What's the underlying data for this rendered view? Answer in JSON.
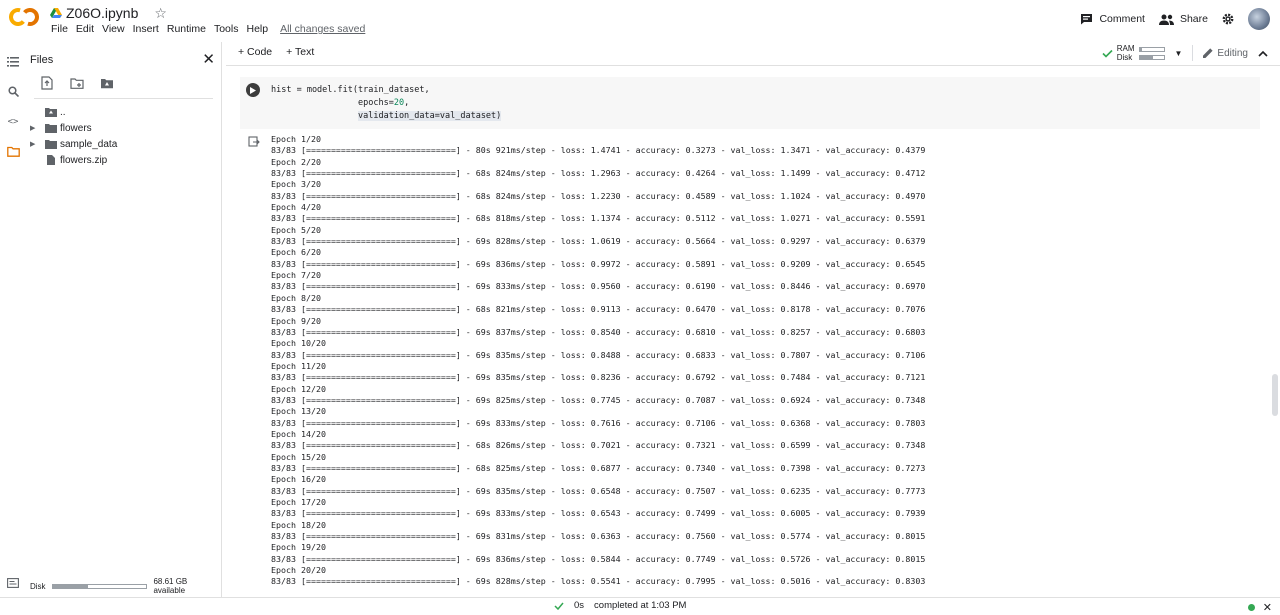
{
  "header": {
    "title": "Z06O.ipynb",
    "menu": [
      "File",
      "Edit",
      "View",
      "Insert",
      "Runtime",
      "Tools",
      "Help"
    ],
    "saved_status": "All changes saved",
    "comment_label": "Comment",
    "share_label": "Share"
  },
  "files": {
    "title": "Files",
    "items": [
      {
        "name": ".."
      },
      {
        "name": "flowers"
      },
      {
        "name": "sample_data"
      },
      {
        "name": "flowers.zip"
      }
    ],
    "disk_label": "Disk",
    "disk_available": "68.61 GB available",
    "disk_fill_fraction": 0.38
  },
  "toolbar": {
    "add_code": "+ Code",
    "add_text": "+ Text",
    "ram_label": "RAM",
    "disk_label": "Disk",
    "ram_fill_fraction": 0.1,
    "disk_fill_fraction": 0.55,
    "editing_label": "Editing"
  },
  "cell": {
    "code_line1": "hist = model.fit(train_dataset,",
    "code_line2_prefix": "                 epochs=",
    "code_epochs_value": "20",
    "code_line2_suffix": ",",
    "code_line3_indent": "                 ",
    "code_line3": "validation_data=val_dataset)"
  },
  "output": {
    "lines": [
      "Epoch 1/20",
      "83/83 [==============================] - 80s 921ms/step - loss: 1.4741 - accuracy: 0.3273 - val_loss: 1.3471 - val_accuracy: 0.4379",
      "Epoch 2/20",
      "83/83 [==============================] - 68s 824ms/step - loss: 1.2963 - accuracy: 0.4264 - val_loss: 1.1499 - val_accuracy: 0.4712",
      "Epoch 3/20",
      "83/83 [==============================] - 68s 824ms/step - loss: 1.2230 - accuracy: 0.4589 - val_loss: 1.1024 - val_accuracy: 0.4970",
      "Epoch 4/20",
      "83/83 [==============================] - 68s 818ms/step - loss: 1.1374 - accuracy: 0.5112 - val_loss: 1.0271 - val_accuracy: 0.5591",
      "Epoch 5/20",
      "83/83 [==============================] - 69s 828ms/step - loss: 1.0619 - accuracy: 0.5664 - val_loss: 0.9297 - val_accuracy: 0.6379",
      "Epoch 6/20",
      "83/83 [==============================] - 69s 836ms/step - loss: 0.9972 - accuracy: 0.5891 - val_loss: 0.9209 - val_accuracy: 0.6545",
      "Epoch 7/20",
      "83/83 [==============================] - 69s 833ms/step - loss: 0.9560 - accuracy: 0.6190 - val_loss: 0.8446 - val_accuracy: 0.6970",
      "Epoch 8/20",
      "83/83 [==============================] - 68s 821ms/step - loss: 0.9113 - accuracy: 0.6470 - val_loss: 0.8178 - val_accuracy: 0.7076",
      "Epoch 9/20",
      "83/83 [==============================] - 69s 837ms/step - loss: 0.8540 - accuracy: 0.6810 - val_loss: 0.8257 - val_accuracy: 0.6803",
      "Epoch 10/20",
      "83/83 [==============================] - 69s 835ms/step - loss: 0.8488 - accuracy: 0.6833 - val_loss: 0.7807 - val_accuracy: 0.7106",
      "Epoch 11/20",
      "83/83 [==============================] - 69s 835ms/step - loss: 0.8236 - accuracy: 0.6792 - val_loss: 0.7484 - val_accuracy: 0.7121",
      "Epoch 12/20",
      "83/83 [==============================] - 69s 825ms/step - loss: 0.7745 - accuracy: 0.7087 - val_loss: 0.6924 - val_accuracy: 0.7348",
      "Epoch 13/20",
      "83/83 [==============================] - 69s 833ms/step - loss: 0.7616 - accuracy: 0.7106 - val_loss: 0.6368 - val_accuracy: 0.7803",
      "Epoch 14/20",
      "83/83 [==============================] - 68s 826ms/step - loss: 0.7021 - accuracy: 0.7321 - val_loss: 0.6599 - val_accuracy: 0.7348",
      "Epoch 15/20",
      "83/83 [==============================] - 68s 825ms/step - loss: 0.6877 - accuracy: 0.7340 - val_loss: 0.7398 - val_accuracy: 0.7273",
      "Epoch 16/20",
      "83/83 [==============================] - 69s 835ms/step - loss: 0.6548 - accuracy: 0.7507 - val_loss: 0.6235 - val_accuracy: 0.7773",
      "Epoch 17/20",
      "83/83 [==============================] - 69s 833ms/step - loss: 0.6543 - accuracy: 0.7499 - val_loss: 0.6005 - val_accuracy: 0.7939",
      "Epoch 18/20",
      "83/83 [==============================] - 69s 831ms/step - loss: 0.6363 - accuracy: 0.7560 - val_loss: 0.5774 - val_accuracy: 0.8015",
      "Epoch 19/20",
      "83/83 [==============================] - 69s 836ms/step - loss: 0.5844 - accuracy: 0.7749 - val_loss: 0.5726 - val_accuracy: 0.8015",
      "Epoch 20/20",
      "83/83 [==============================] - 69s 828ms/step - loss: 0.5541 - accuracy: 0.7995 - val_loss: 0.5016 - val_accuracy: 0.8303"
    ]
  },
  "status": {
    "exec_time": "0s",
    "completed": "completed at 1:03 PM"
  },
  "colors": {
    "accent_orange": "#f9ab00",
    "accent_orange_dark": "#e37400",
    "number_green": "#098658",
    "connected_green": "#34a853"
  }
}
